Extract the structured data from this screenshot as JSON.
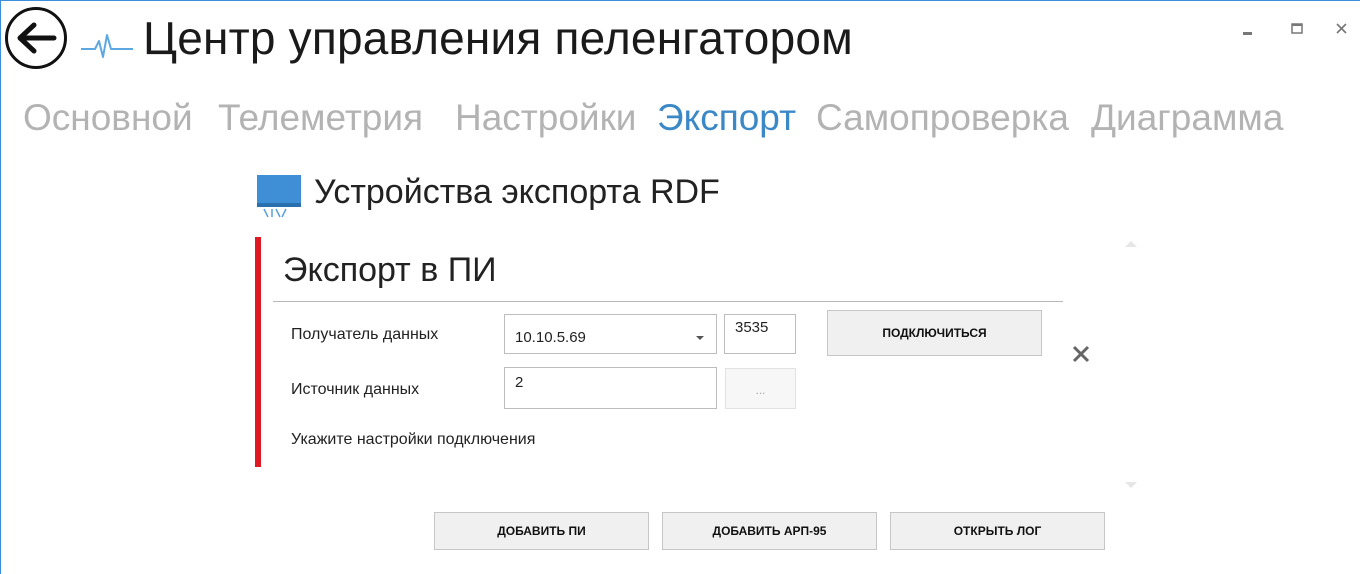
{
  "window": {
    "title": "Центр управления пеленгатором",
    "accent_color": "#3c8fd9"
  },
  "icons": {
    "back": "back-arrow-icon",
    "logo": "pulse-logo-icon",
    "section": "monitor-icon",
    "remove": "close-icon"
  },
  "nav": {
    "tabs": [
      {
        "label": "Основной",
        "active": false
      },
      {
        "label": "Телеметрия",
        "active": false
      },
      {
        "label": "Настройки",
        "active": false
      },
      {
        "label": "Экспорт",
        "active": true
      },
      {
        "label": "Самопроверка",
        "active": false
      },
      {
        "label": "Диаграмма",
        "active": false
      }
    ],
    "active_color": "#3b88c7",
    "inactive_color": "#b3b3b3"
  },
  "section": {
    "title": "Устройства экспорта RDF"
  },
  "card": {
    "title": "Экспорт в ПИ",
    "accent_color": "#e01822",
    "receiver_label": "Получатель данных",
    "receiver_value": "10.10.5.69",
    "port_value": "3535",
    "connect_label": "ПОДКЛЮЧИТЬСЯ",
    "source_label": "Источник данных",
    "source_value": "2",
    "browse_label": "...",
    "status_text": "Укажите настройки подключения"
  },
  "footer": {
    "add_pi_label": "ДОБАВИТЬ ПИ",
    "add_arp_label": "ДОБАВИТЬ АРП-95",
    "open_log_label": "ОТКРЫТЬ ЛОГ"
  }
}
